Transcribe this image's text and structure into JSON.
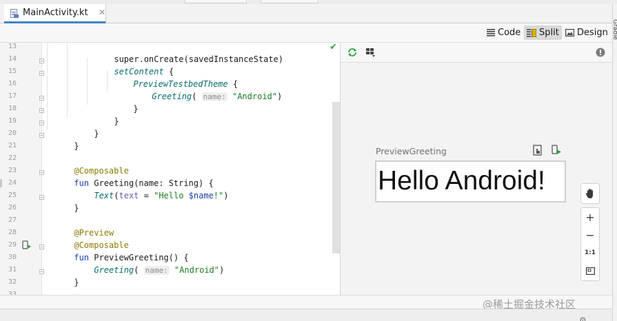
{
  "tab": {
    "title": "MainActivity.kt",
    "close_glyph": "✕",
    "icon": "kotlin-file-icon"
  },
  "right_strip": {
    "label": "Gradle"
  },
  "view_modes": [
    {
      "label": "Code",
      "icon": "lines-icon",
      "active": false
    },
    {
      "label": "Split",
      "icon": "split-icon",
      "active": true
    },
    {
      "label": "Design",
      "icon": "image-icon",
      "active": false
    }
  ],
  "editor": {
    "line_numbers": [
      "13",
      "14",
      "15",
      "16",
      "17",
      "18",
      "19",
      "20",
      "21",
      "22",
      "23",
      "24",
      "25",
      "26",
      "27",
      "28",
      "29",
      "30",
      "31",
      "32",
      "33"
    ],
    "status_check": "✔",
    "lines": {
      "l13": {
        "a": "super.onCreate(savedInstanceState)"
      },
      "l14": {
        "a": "setContent",
        "b": " {"
      },
      "l15": {
        "a": "PreviewTestbedTheme",
        "b": " {"
      },
      "l16": {
        "a": "Greeting",
        "b": "(",
        "hint": "name:",
        "c": "\"Android\"",
        "d": ")"
      },
      "l17": {
        "a": "}"
      },
      "l18": {
        "a": "}"
      },
      "l19": {
        "a": "}"
      },
      "l20": {
        "a": "}"
      },
      "l22": {
        "a": "@Composable"
      },
      "l23": {
        "kw": "fun",
        "a": " Greeting(name: String) {"
      },
      "l24": {
        "a": "Text",
        "b": "(",
        "p": "text",
        "c": " = ",
        "s1": "\"Hello ",
        "v": "$name",
        "s2": "!\"",
        "d": ")"
      },
      "l25": {
        "a": "}"
      },
      "l27": {
        "a": "@Preview"
      },
      "l28": {
        "a": "@Composable"
      },
      "l29": {
        "kw": "fun",
        "a": " PreviewGreeting() {"
      },
      "l30": {
        "a": "Greeting",
        "b": "(",
        "hint": "name:",
        "c": "\"Android\"",
        "d": ")"
      },
      "l31": {
        "a": "}"
      }
    }
  },
  "preview": {
    "title": "PreviewGreeting",
    "rendered_text": "Hello Android!",
    "zoom": {
      "zoom_in": "+",
      "zoom_out": "−",
      "actual_size": "1:1"
    }
  },
  "watermark": "@稀土掘金技术社区",
  "colors": {
    "accent": "#4083c9",
    "check": "#2fa243",
    "keyword": "#1a3fa6",
    "string": "#1b7a1b",
    "annotation": "#8a7a00"
  }
}
